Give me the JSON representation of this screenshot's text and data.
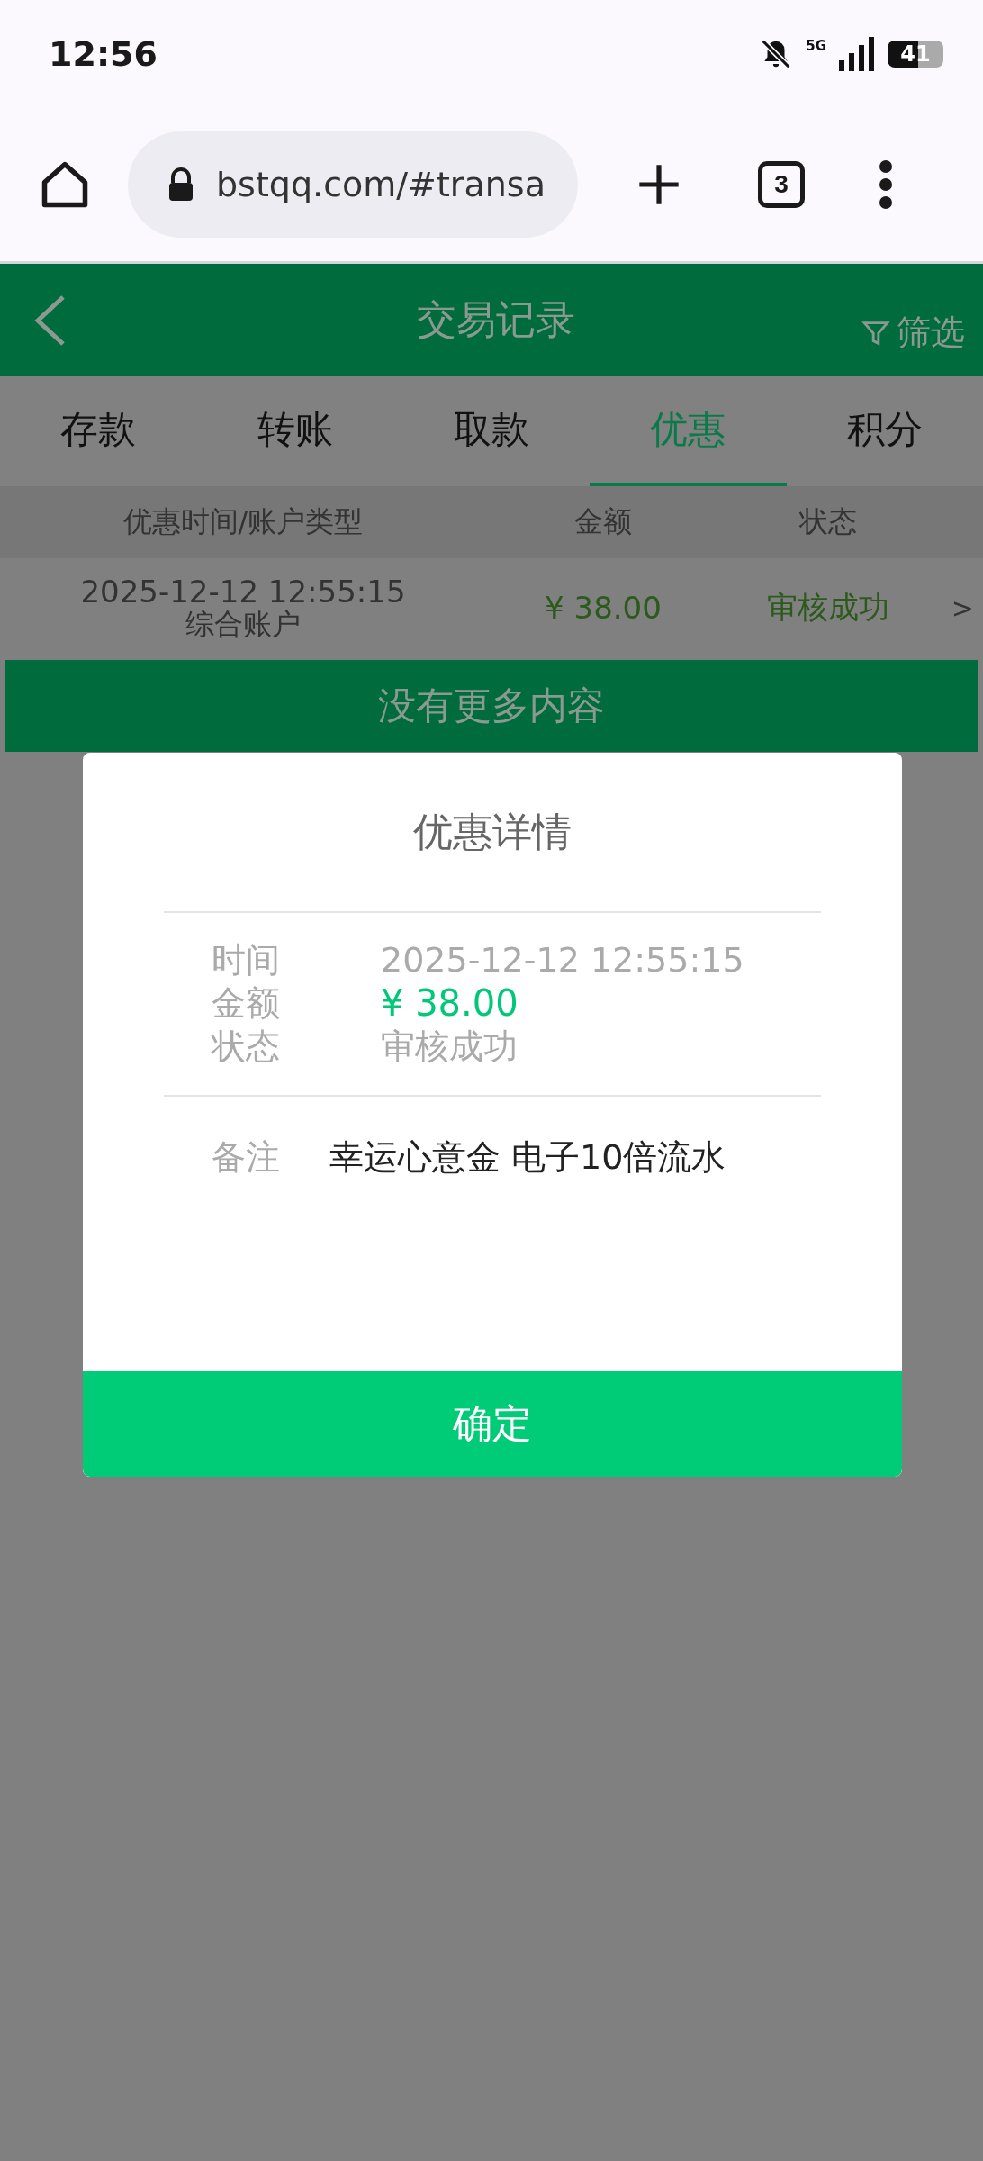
{
  "status_bar": {
    "time": "12:56",
    "network": "5G",
    "battery": "41"
  },
  "browser": {
    "url": "bstqq.com/#transa",
    "tab_count": "3"
  },
  "header": {
    "title": "交易记录",
    "filter": "筛选"
  },
  "tabs": [
    {
      "label": "存款",
      "selected": false
    },
    {
      "label": "转账",
      "selected": false
    },
    {
      "label": "取款",
      "selected": false
    },
    {
      "label": "优惠",
      "selected": true
    },
    {
      "label": "积分",
      "selected": false
    }
  ],
  "table": {
    "columns": [
      "优惠时间/账户类型",
      "金额",
      "状态"
    ],
    "rows": [
      {
        "time": "2025-12-12 12:55:15",
        "account": "综合账户",
        "amount": "¥ 38.00",
        "status": "审核成功",
        "arrow": ">"
      }
    ]
  },
  "footer_notice": "没有更多内容",
  "dialog": {
    "title": "优惠详情",
    "fields": [
      {
        "label": "时间",
        "value": "2025-12-12 12:55:15",
        "kind": "plain"
      },
      {
        "label": "金额",
        "value": "¥ 38.00",
        "kind": "amount"
      },
      {
        "label": "状态",
        "value": "审核成功",
        "kind": "plain"
      }
    ],
    "note": {
      "label": "备注",
      "value": "幸运心意金 电子10倍流水"
    },
    "confirm": "确定"
  }
}
